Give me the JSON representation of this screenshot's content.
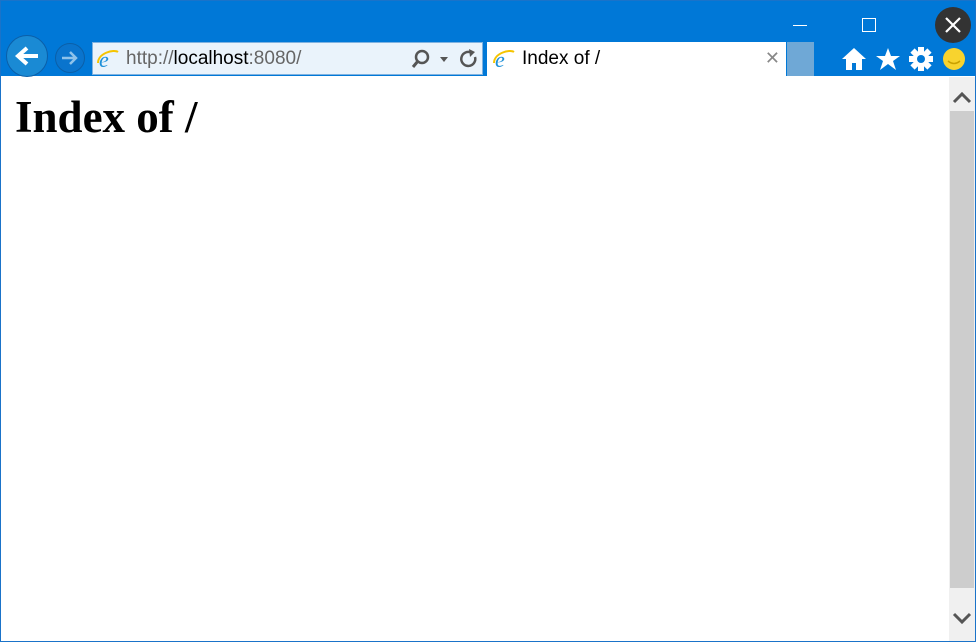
{
  "window": {
    "accent": "#0078d7"
  },
  "address_bar": {
    "url_prefix": "http://",
    "url_host": "localhost",
    "url_suffix": ":8080/"
  },
  "tab": {
    "title": "Index of /"
  },
  "toolbar_icons": [
    "home-icon",
    "favorites-star-icon",
    "settings-gear-icon",
    "feedback-smiley-icon"
  ],
  "page": {
    "heading": "Index of /"
  }
}
